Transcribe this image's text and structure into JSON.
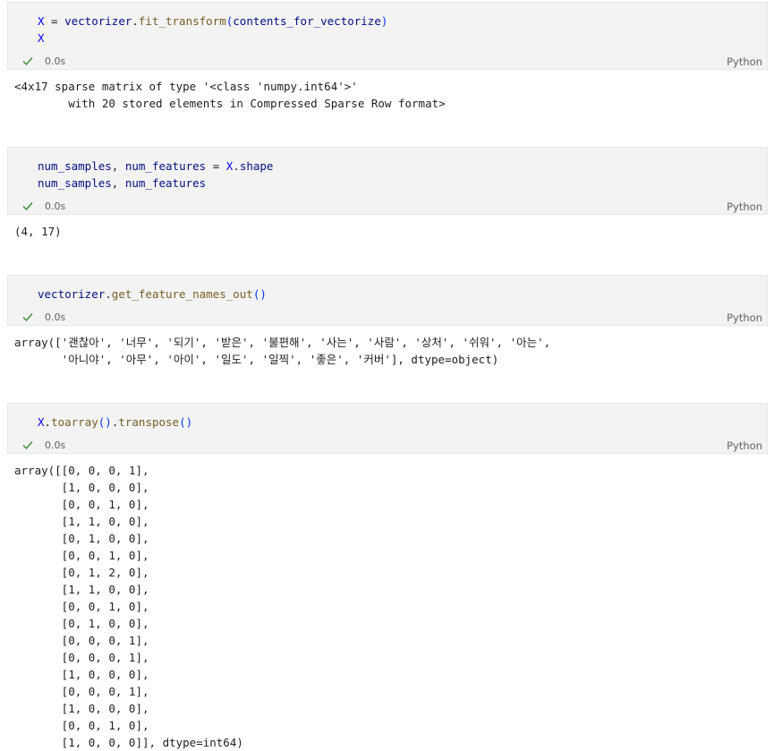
{
  "cells": [
    {
      "code_lines": [
        [
          {
            "t": "X",
            "c": "v"
          },
          {
            "t": " = ",
            "c": ""
          },
          {
            "t": "vectorizer",
            "c": "n"
          },
          {
            "t": ".",
            "c": ""
          },
          {
            "t": "fit_transform",
            "c": "f"
          },
          {
            "t": "(",
            "c": "p"
          },
          {
            "t": "contents_for_vectorize",
            "c": "n"
          },
          {
            "t": ")",
            "c": "p"
          }
        ],
        [
          {
            "t": "X",
            "c": "v"
          }
        ]
      ],
      "status": {
        "duration": "0.0s",
        "language": "Python",
        "icon": "check-icon",
        "icon_color": "#388a34"
      },
      "output_lines": [
        "<4x17 sparse matrix of type '<class 'numpy.int64'>'",
        "\twith 20 stored elements in Compressed Sparse Row format>"
      ]
    },
    {
      "code_lines": [
        [
          {
            "t": "num_samples",
            "c": "n"
          },
          {
            "t": ", ",
            "c": ""
          },
          {
            "t": "num_features",
            "c": "n"
          },
          {
            "t": " = ",
            "c": ""
          },
          {
            "t": "X",
            "c": "v"
          },
          {
            "t": ".",
            "c": ""
          },
          {
            "t": "shape",
            "c": "n"
          }
        ],
        [
          {
            "t": "num_samples",
            "c": "n"
          },
          {
            "t": ", ",
            "c": ""
          },
          {
            "t": "num_features",
            "c": "n"
          }
        ]
      ],
      "status": {
        "duration": "0.0s",
        "language": "Python",
        "icon": "check-icon",
        "icon_color": "#388a34"
      },
      "output_lines": [
        "(4, 17)"
      ]
    },
    {
      "code_lines": [
        [
          {
            "t": "vectorizer",
            "c": "n"
          },
          {
            "t": ".",
            "c": ""
          },
          {
            "t": "get_feature_names_out",
            "c": "f"
          },
          {
            "t": "()",
            "c": "p"
          }
        ]
      ],
      "status": {
        "duration": "0.0s",
        "language": "Python",
        "icon": "check-icon",
        "icon_color": "#388a34"
      },
      "output_lines": [
        "array(['괜찮아', '너무', '되기', '받은', '불편해', '사는', '사람', '상처', '쉬워', '아는',",
        "       '아니야', '아무', '아이', '일도', '일찍', '좋은', '커버'], dtype=object)"
      ]
    },
    {
      "code_lines": [
        [
          {
            "t": "X",
            "c": "v"
          },
          {
            "t": ".",
            "c": ""
          },
          {
            "t": "toarray",
            "c": "f"
          },
          {
            "t": "()",
            "c": "p"
          },
          {
            "t": ".",
            "c": ""
          },
          {
            "t": "transpose",
            "c": "f"
          },
          {
            "t": "()",
            "c": "p"
          }
        ]
      ],
      "status": {
        "duration": "0.0s",
        "language": "Python",
        "icon": "check-icon",
        "icon_color": "#388a34"
      },
      "output_lines": [
        "array([[0, 0, 0, 1],",
        "       [1, 0, 0, 0],",
        "       [0, 0, 1, 0],",
        "       [1, 1, 0, 0],",
        "       [0, 1, 0, 0],",
        "       [0, 0, 1, 0],",
        "       [0, 1, 2, 0],",
        "       [1, 1, 0, 0],",
        "       [0, 0, 1, 0],",
        "       [0, 1, 0, 0],",
        "       [0, 0, 0, 1],",
        "       [0, 0, 0, 1],",
        "       [1, 0, 0, 0],",
        "       [0, 0, 0, 1],",
        "       [1, 0, 0, 0],",
        "       [0, 0, 1, 0],",
        "       [1, 0, 0, 0]], dtype=int64)"
      ]
    }
  ]
}
